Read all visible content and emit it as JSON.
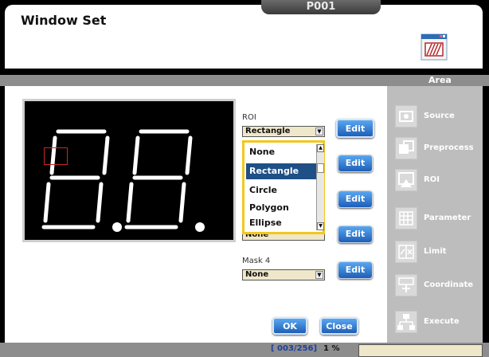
{
  "window": {
    "title": "Window Set",
    "program": "P001"
  },
  "band": {
    "label": "Area"
  },
  "roi": {
    "label": "ROI",
    "selected": "Rectangle",
    "options": [
      "None",
      "Rectangle",
      "Circle",
      "Polygon",
      "Ellipse"
    ],
    "hidden_value_partial": "None"
  },
  "mask4": {
    "label": "Mask 4",
    "selected": "None"
  },
  "edit_label": "Edit",
  "sidebar": {
    "items": [
      {
        "label": "Source",
        "icon": "camera-icon"
      },
      {
        "label": "Preprocess",
        "icon": "image-process-icon"
      },
      {
        "label": "ROI",
        "icon": "roi-icon"
      },
      {
        "label": "Parameter",
        "icon": "grid-icon"
      },
      {
        "label": "Limit",
        "icon": "limit-icon"
      },
      {
        "label": "Coordinate",
        "icon": "coordinate-icon"
      },
      {
        "label": "Execute",
        "icon": "execute-icon"
      }
    ]
  },
  "buttons": {
    "ok": "OK",
    "close": "Close"
  },
  "status": {
    "count": "[ 003/256]",
    "percent": "1 %"
  },
  "colors": {
    "accent": "#1d5fb8",
    "highlight": "#1e4f86",
    "dropdown_border": "#f2c81d",
    "roi_outline": "#c62828"
  }
}
